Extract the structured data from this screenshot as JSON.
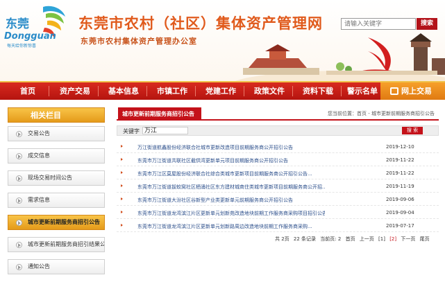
{
  "header": {
    "logo_text_cn": "东莞",
    "logo_text_en": "Dongguan",
    "logo_tagline": "每天给你新惊喜",
    "title": "东莞市农村（社区）集体资产管理网",
    "subtitle": "东莞市农村集体资产管理办公室",
    "search_placeholder": "请输入关键字",
    "search_button": "搜索"
  },
  "nav": {
    "items": [
      "首页",
      "资产交易",
      "基本信息",
      "市镇工作",
      "党建工作",
      "政策文件",
      "资料下载",
      "警示名单"
    ],
    "login": "网上交易"
  },
  "sidebar": {
    "title": "相关栏目",
    "items": [
      {
        "label": "交易公告",
        "active": false
      },
      {
        "label": "成交信息",
        "active": false
      },
      {
        "label": "现场交易时间公告",
        "active": false
      },
      {
        "label": "需求信息",
        "active": false
      },
      {
        "label": "城市更新前期服务商招引公告",
        "active": true
      },
      {
        "label": "城市更新前期服务商招引结果公示",
        "active": false
      },
      {
        "label": "通知公告",
        "active": false
      }
    ]
  },
  "main": {
    "tab_title": "城市更新前期服务商招引公告",
    "breadcrumb": "您当前位置：首页 - 城市更新前期服务商招引公告",
    "keyword_label": "关键字",
    "keyword_value": "万江",
    "search_button": "搜 索",
    "rows": [
      {
        "title": "万江街道航鑫股份经济联合社城市更新改造项目前期服务商公开招引公告",
        "date": "2019-12-10"
      },
      {
        "title": "东莞市万江街道共联社区截供湾更新单元项目前期服务商公开招引公告",
        "date": "2019-11-22"
      },
      {
        "title": "东莞市万江区莫屋股份经济联合社综合类城市更新项目前期服务商公开招引公告...",
        "date": "2019-11-22"
      },
      {
        "title": "东莞市万江街道拔蛟窝社区栖涌社区东方建材城商住类城市更新项目前期服务商公开招...",
        "date": "2019-11-19"
      },
      {
        "title": "东莞市万江街道大汾社区谷新型产业类更新单元前期服务商公开招引公告",
        "date": "2019-09-06"
      },
      {
        "title": "东莞市万江街道龙湾滨江片区更新单元划新苑改造地块前期工作服务商采购项目招引公告",
        "date": "2019-09-04"
      },
      {
        "title": "东莞市万江街道龙湾滨江片区更新单元划新路周边改造地块前期工作服务商采购...",
        "date": "2019-07-17"
      }
    ],
    "pager": {
      "total_pages": "共 2页",
      "total_records": "22 条记录",
      "current": "当前页: 2",
      "first": "首页",
      "prev": "上一页",
      "page1": "[1]",
      "page2": "[2]",
      "next": "下一页",
      "last": "尾页"
    }
  }
}
